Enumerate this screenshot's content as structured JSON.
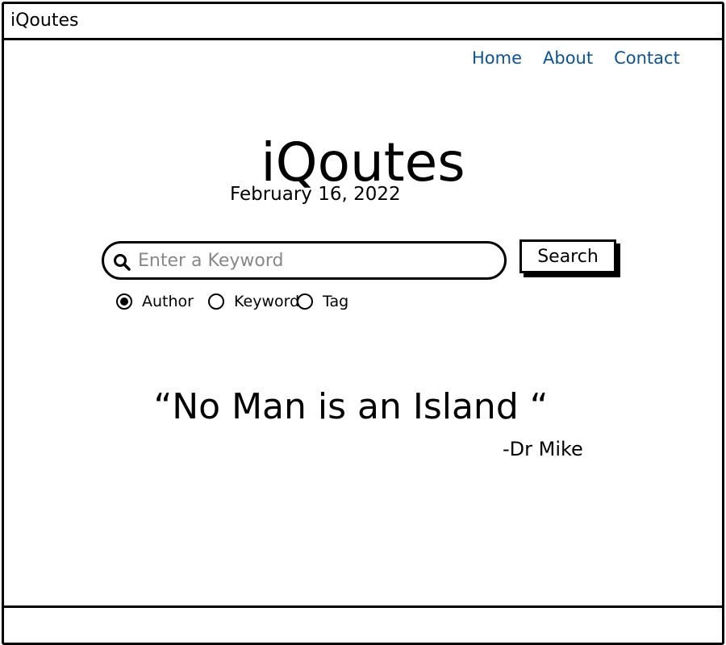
{
  "window": {
    "title": "iQoutes"
  },
  "nav": {
    "items": [
      {
        "label": "Home"
      },
      {
        "label": "About"
      },
      {
        "label": "Contact"
      }
    ]
  },
  "header": {
    "title": "iQoutes",
    "date": "February 16, 2022"
  },
  "search": {
    "placeholder": "Enter a Keyword",
    "value": "",
    "button_label": "Search",
    "icon": "search-icon"
  },
  "filters": {
    "selected": "Author",
    "options": [
      {
        "label": "Author",
        "checked": true
      },
      {
        "label": "Keyword",
        "checked": false
      },
      {
        "label": "Tag",
        "checked": false
      }
    ]
  },
  "quote": {
    "text": "“No Man is an Island “",
    "author": "-Dr Mike"
  },
  "colors": {
    "nav_link": "#0b5394",
    "border": "#000000",
    "placeholder": "#888888"
  }
}
